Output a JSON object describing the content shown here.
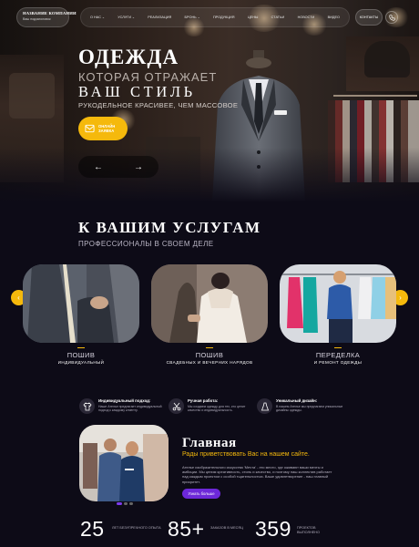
{
  "header": {
    "logo_name": "НАЗВАНИЕ КОМПАНИИ",
    "logo_sub": "Ваш подзаголовок",
    "nav": [
      {
        "label": "О НАС",
        "dropdown": true
      },
      {
        "label": "УСЛУГИ",
        "dropdown": true
      },
      {
        "label": "РЕАЛИЗАЦИЯ",
        "dropdown": false
      },
      {
        "label": "БРОНЬ",
        "dropdown": true
      },
      {
        "label": "ПРОДУКЦИЯ",
        "dropdown": false
      },
      {
        "label": "ЦЕНЫ",
        "dropdown": false
      },
      {
        "label": "СТАТЬИ",
        "dropdown": false
      },
      {
        "label": "НОВОСТИ",
        "dropdown": false
      },
      {
        "label": "ВИДЕО",
        "dropdown": false
      }
    ],
    "contacts": "КОНТАКТЫ",
    "caret": "⌄"
  },
  "hero": {
    "title": "ОДЕЖДА",
    "line1": "КОТОРАЯ ОТРАЖАЕТ",
    "line2": "ВАШ СТИЛЬ",
    "line3": "РУКОДЕЛЬНОЕ КРАСИВЕЕ, ЧЕМ МАССОВОЕ",
    "cta_line1": "Онлайн",
    "cta_line2": "заявка",
    "prev": "←",
    "next": "→"
  },
  "services": {
    "title": "К ВАШИМ УСЛУГАМ",
    "subtitle": "ПРОФЕССИОНАЛЫ В СВОЕМ ДЕЛЕ",
    "arrow_left": "‹",
    "arrow_right": "›",
    "items": [
      {
        "title": "ПОШИВ",
        "subtitle": "ИНДИВИДУАЛЬНЫЙ"
      },
      {
        "title": "ПОШИВ",
        "subtitle": "СВАДЕБНЫХ И ВЕЧЕРНИХ НАРЯДОВ"
      },
      {
        "title": "ПЕРЕДЕЛКА",
        "subtitle": "И РЕМОНТ ОДЕЖДЫ"
      }
    ]
  },
  "features": [
    {
      "icon": "shirt-icon",
      "title": "Индивидуальный подход:",
      "text": "Наше Ателье предлагает индивидуальный подход к каждому клиенту."
    },
    {
      "icon": "scissors-icon",
      "title": "Ручная работа:",
      "text": "Мы создаем одежду для тех, кто ценит качество и индивидуальность."
    },
    {
      "icon": "dress-icon",
      "title": "Уникальный дизайн:",
      "text": "В нашем Ателье мы предлагаем уникальные дизайны одежды."
    }
  ],
  "main": {
    "title": "Главная",
    "subtitle": "Рады приветствовать Вас на нашем сайте.",
    "text": "Ателье изобразительного искусства 'Мечта' - это место, где оживают ваши мечты и амбиции. Мы ценим креативность, стиль и качество, и поэтому наш коллектив работает над каждым проектом с особой тщательностью. Ваше удовлетворение - наш главный приоритет.",
    "button": "Узнать больше"
  },
  "stats": [
    {
      "value": "25",
      "label": "ЛЕТ БЕЗУПРЕЧНОГО ОПЫТА"
    },
    {
      "value": "85+",
      "label": "ЗАКАЗОВ В МЕСЯЦ"
    },
    {
      "value": "359",
      "label": "ПРОЕКТОВ ВЫПОЛНЕНО"
    }
  ],
  "colors": {
    "accent": "#f5b90c",
    "purple": "#6d28d9",
    "background": "#0d0b17"
  }
}
